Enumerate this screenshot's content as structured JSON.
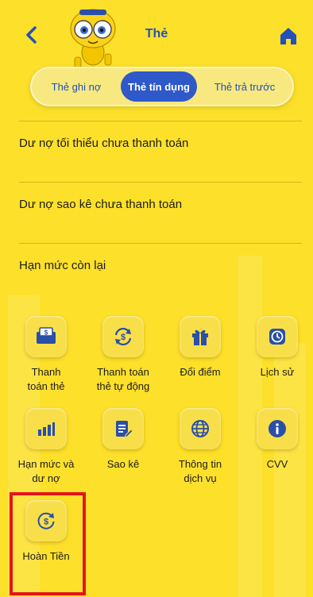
{
  "header": {
    "title": "Thẻ",
    "back_icon": "chevron-left-icon",
    "home_icon": "home-icon"
  },
  "tabs": [
    {
      "label": "Thẻ ghi nợ",
      "active": false
    },
    {
      "label": "Thẻ tín dụng",
      "active": true
    },
    {
      "label": "Thẻ trả trước",
      "active": false
    }
  ],
  "info": {
    "min_debt_label": "Dư nợ tối thiểu chưa thanh toán",
    "statement_debt_label": "Dư nợ sao kê chưa thanh toán",
    "remaining_limit_label": "Hạn mức còn lại"
  },
  "services": [
    {
      "label": "Thanh\ntoán thẻ",
      "icon": "card-payment-icon"
    },
    {
      "label": "Thanh toán\nthẻ tự động",
      "icon": "auto-payment-icon"
    },
    {
      "label": "Đổi điểm",
      "icon": "gift-icon"
    },
    {
      "label": "Lịch sử",
      "icon": "clock-icon"
    },
    {
      "label": "Hạn mức và\ndư nợ",
      "icon": "bar-chart-icon"
    },
    {
      "label": "Sao kê",
      "icon": "statement-icon"
    },
    {
      "label": "Thông tin\ndịch vụ",
      "icon": "globe-icon"
    },
    {
      "label": "CVV",
      "icon": "info-icon"
    },
    {
      "label": "Hoàn Tiền",
      "icon": "cashback-icon"
    }
  ],
  "colors": {
    "background": "#fde02a",
    "accent": "#2f58c9",
    "highlight": "#e4141a"
  }
}
